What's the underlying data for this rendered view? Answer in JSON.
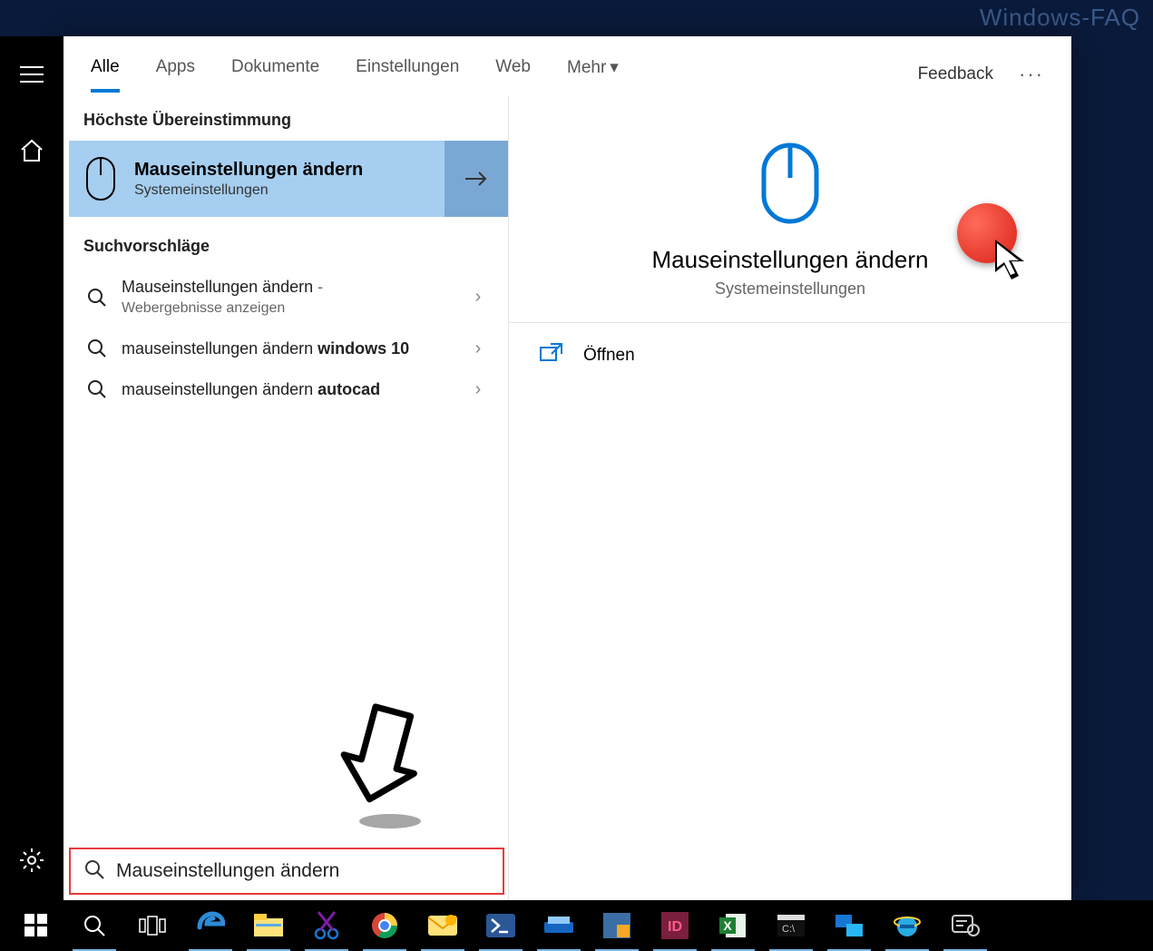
{
  "watermark": "Windows-FAQ",
  "tabs": {
    "items": [
      "Alle",
      "Apps",
      "Dokumente",
      "Einstellungen",
      "Web",
      "Mehr"
    ],
    "active_index": 0,
    "feedback": "Feedback"
  },
  "left": {
    "best_header": "Höchste Übereinstimmung",
    "best": {
      "title": "Mauseinstellungen ändern",
      "sub": "Systemeinstellungen"
    },
    "sugg_header": "Suchvorschläge",
    "suggestions": [
      {
        "pre": "Mauseinstellungen ändern",
        "bold": "",
        "suffix": " -",
        "sub": "Webergebnisse anzeigen"
      },
      {
        "pre": "mauseinstellungen ändern ",
        "bold": "windows 10",
        "suffix": "",
        "sub": ""
      },
      {
        "pre": "mauseinstellungen ändern ",
        "bold": "autocad",
        "suffix": "",
        "sub": ""
      }
    ]
  },
  "right": {
    "title": "Mauseinstellungen ändern",
    "sub": "Systemeinstellungen",
    "open": "Öffnen"
  },
  "search": {
    "value": "Mauseinstellungen ändern"
  },
  "taskbar_icons": [
    "start",
    "search",
    "taskview",
    "edge",
    "explorer",
    "snip",
    "chrome",
    "mail",
    "powershell",
    "scanner",
    "vs",
    "onenote",
    "excel",
    "cmd",
    "mstsc",
    "ie",
    "feedback"
  ]
}
